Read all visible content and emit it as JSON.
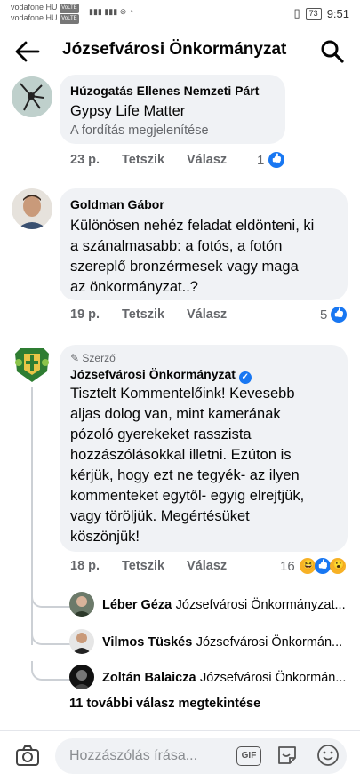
{
  "status_bar": {
    "carrier1": "vodafone HU",
    "carrier2": "vodafone HU",
    "volte": "VoLTE",
    "battery": "73",
    "time": "9:51"
  },
  "header": {
    "title": "Józsefvárosi Önkormányzat",
    "back_icon": "arrow-left-icon",
    "search_icon": "search-icon"
  },
  "comments": [
    {
      "author": "Húzogatás Ellenes Nemzeti Párt",
      "text": "Gypsy Life Matter",
      "translate": "A fordítás megjelenítése",
      "time": "23 p.",
      "like": "Tetszik",
      "reply": "Válasz",
      "reactions": "1"
    },
    {
      "author": "Goldman Gábor",
      "lines": [
        "Különösen nehéz feladat eldönteni, ki",
        "a szánalmasabb: a fotós, a fotón",
        "szereplő bronzérmesek vagy maga",
        "az önkormányzat..?"
      ],
      "time": "19 p.",
      "like": "Tetszik",
      "reply": "Válasz",
      "reactions": "5"
    },
    {
      "badge": "Szerző",
      "author": "Józsefvárosi Önkormányzat",
      "lines": [
        "Tisztelt Kommentelőink! Kevesebb",
        "aljas dolog van, mint kamerának",
        "pózoló gyerekeket rasszista",
        "hozzászólásokkal illetni. Ezúton is",
        "kérjük, hogy ezt ne tegyék- az ilyen",
        "kommenteket egytől- egyig elrejtjük,",
        "vagy töröljük. Megértésüket",
        "köszönjük!"
      ],
      "time": "18 p.",
      "like": "Tetszik",
      "reply": "Válasz",
      "reactions": "16"
    }
  ],
  "replies": [
    {
      "name": "Léber Géza",
      "tag": "Józsefvárosi Önkormányzat..."
    },
    {
      "name": "Vilmos Tüskés",
      "tag": "Józsefvárosi Önkormán..."
    },
    {
      "name": "Zoltán Balaicza",
      "tag": "Józsefvárosi Önkormán..."
    }
  ],
  "more_replies": "11 további válasz megtekintése",
  "composer": {
    "placeholder": "Hozzászólás írása...",
    "gif": "GIF"
  },
  "colors": {
    "accent": "#1877f2",
    "bubble": "#f0f2f5",
    "muted": "#65676b"
  }
}
